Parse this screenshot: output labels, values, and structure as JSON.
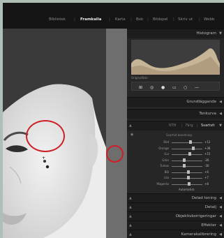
{
  "modules": [
    {
      "label": "Bibliotek",
      "active": false
    },
    {
      "label": "Framkalla",
      "active": true
    },
    {
      "label": "Karta",
      "active": false
    },
    {
      "label": "Bok",
      "active": false
    },
    {
      "label": "Bildspel",
      "active": false
    },
    {
      "label": "Skriv ut",
      "active": false
    },
    {
      "label": "Webb",
      "active": false
    }
  ],
  "panels": {
    "histogram": "Histogram",
    "original": "Originalfoto",
    "grundlaggande": "Grundläggande",
    "tonkurva": "Tonkurva",
    "hsl_tabs": [
      "NTH",
      "Färg",
      "Svartvit"
    ],
    "svartvit_title": "Svartvit blandning",
    "svartvit_sliders": [
      {
        "label": "Röd",
        "value": "+12",
        "position": 0.62
      },
      {
        "label": "Orange",
        "value": "+36",
        "position": 0.7
      },
      {
        "label": "Gul",
        "value": "+15",
        "position": 0.6
      },
      {
        "label": "Grön",
        "value": "-26",
        "position": 0.42
      },
      {
        "label": "Turkos",
        "value": "-30",
        "position": 0.4
      },
      {
        "label": "Blå",
        "value": "+6",
        "position": 0.54
      },
      {
        "label": "Lila",
        "value": "+7",
        "position": 0.55
      },
      {
        "label": "Magenta",
        "value": "+8",
        "position": 0.56
      }
    ],
    "auto": "Automatisk",
    "delad_toning": "Delad toning",
    "detalj": "Detalj",
    "objektivkorrigeringar": "Objektivkorrigeringar",
    "effekter": "Effekter",
    "kamerakalibrering": "Kamerakalibrering"
  },
  "icons": [
    "crop-overlay-icon",
    "spot-removal-icon",
    "red-eye-icon",
    "graduated-filter-icon",
    "radial-filter-icon",
    "adjustment-brush-icon"
  ],
  "annotation_color": "#cc1f26"
}
